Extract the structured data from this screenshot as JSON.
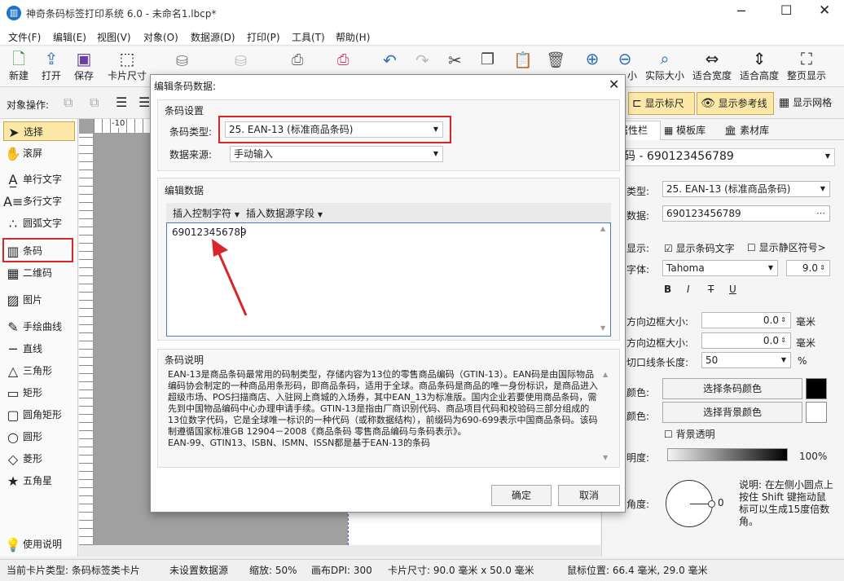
{
  "app": {
    "title": "神奇条码标签打印系统 6.0 - 未命名1.lbcp*"
  },
  "menu": [
    "文件(F)",
    "编辑(E)",
    "视图(V)",
    "对象(O)",
    "数据源(D)",
    "打印(P)",
    "工具(T)",
    "帮助(H)"
  ],
  "toolbar": {
    "new": "新建",
    "open": "打开",
    "save": "保存",
    "card_size": "卡片尺寸",
    "zoom_in": "放大",
    "zoom_out": "缩小",
    "actual_size": "实际大小",
    "fit_width": "适合宽度",
    "fit_height": "适合高度",
    "full_page": "整页显示",
    "partial_left": "小"
  },
  "objbar": {
    "label": "对象操作:",
    "show_ruler": "显示标尺",
    "show_guides": "显示参考线",
    "show_grid": "显示网格"
  },
  "tools": {
    "select": "选择",
    "scroll": "滚屏",
    "single_text": "单行文字",
    "multi_text": "多行文字",
    "arc_text": "圆弧文字",
    "barcode": "条码",
    "qrcode": "二维码",
    "image": "图片",
    "freehand": "手绘曲线",
    "line": "直线",
    "triangle": "三角形",
    "rect": "矩形",
    "rounded_rect": "圆角矩形",
    "circle": "圆形",
    "diamond": "菱形",
    "star": "五角星",
    "help": "使用说明"
  },
  "ruler": {
    "tick": "-10"
  },
  "right_panel": {
    "tabs": {
      "properties": "属性栏",
      "templates": "模板库",
      "materials": "素材库"
    },
    "object_select": "码 - 690123456789",
    "type_label": "类型:",
    "type_value": "25. EAN-13 (标准商品条码)",
    "data_label": "数据:",
    "data_value": "690123456789",
    "display_label": "显示:",
    "show_text": "显示条码文字",
    "show_quiet": "显示静区符号>",
    "font_label": "字体:",
    "font_value": "Tahoma",
    "font_size": "9.0",
    "bold": "B",
    "italic": "I",
    "strike": "T",
    "underline": "U",
    "hmargin_label": "方向边框大小:",
    "hmargin_value": "0.0",
    "vmargin_label": "方向边框大小:",
    "vmargin_value": "0.0",
    "unit_mm": "毫米",
    "cut_label": "切口线条长度:",
    "cut_value": "50",
    "percent": "%",
    "bar_color_label": "颜色:",
    "bar_color_btn": "选择条码颜色",
    "bg_color_label": "颜色:",
    "bg_color_btn": "选择背景颜色",
    "bg_transparent": "背景透明",
    "opacity_label": "明度:",
    "opacity_value": "100%",
    "angle_label": "角度:",
    "angle_value": "0",
    "note": "说明: 在左侧小圆点上按住 Shift 键拖动鼠标可以生成15度倍数角。"
  },
  "dialog": {
    "title": "编辑条码数据:",
    "group_settings": "条码设置",
    "type_label": "条码类型:",
    "type_value": "25. EAN-13 (标准商品条码)",
    "source_label": "数据来源:",
    "source_value": "手动输入",
    "group_edit": "编辑数据",
    "insert_ctrl": "插入控制字符",
    "insert_field": "插入数据源字段",
    "data_value": "690123456789",
    "group_desc": "条码说明",
    "description": "EAN-13是商品条码最常用的码制类型，存储内容为13位的零售商品编码（GTIN-13）。EAN码是由国际物品编码协会制定的一种商品用条形码，即商品条码，适用于全球。商品条码是商品的唯一身份标识，是商品进入超级市场、POS扫描商店、入驻网上商城的入场券，其中EAN_13为标准版。国内企业若要使用商品条码，需先到中国物品编码中心办理申请手续。GTIN-13是指由厂商识别代码、商品项目代码和校验码三部分组成的13位数字代码，它是全球唯一标识的一种代码（或称数据结构），前缀码为690-699表示中国商品条码。该码制遵循国家标准GB 12904－2008《商品条码 零售商品编码与条码表示》。",
    "description2": "EAN-99、GTIN13、ISBN、ISMN、ISSN都是基于EAN-13的条码",
    "ok": "确定",
    "cancel": "取消"
  },
  "status": {
    "card_type": "当前卡片类型: 条码标签类卡片",
    "datasource": "未设置数据源",
    "zoom": "缩放: 50%",
    "dpi": "画布DPI: 300",
    "card_size": "卡片尺寸: 90.0 毫米 x 50.0 毫米",
    "mouse_pos": "鼠标位置: 66.4 毫米, 29.0 毫米"
  },
  "colors": {
    "accent": "#d9262b",
    "brand": "#1a73c8"
  }
}
